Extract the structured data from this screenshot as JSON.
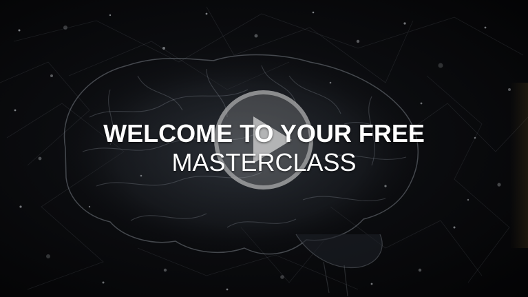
{
  "video": {
    "headline_bold": "WELCOME TO YOUR FREE",
    "headline_light": "MASTERCLASS",
    "play_icon": "play-icon",
    "background_image": "neural-brain-network"
  }
}
